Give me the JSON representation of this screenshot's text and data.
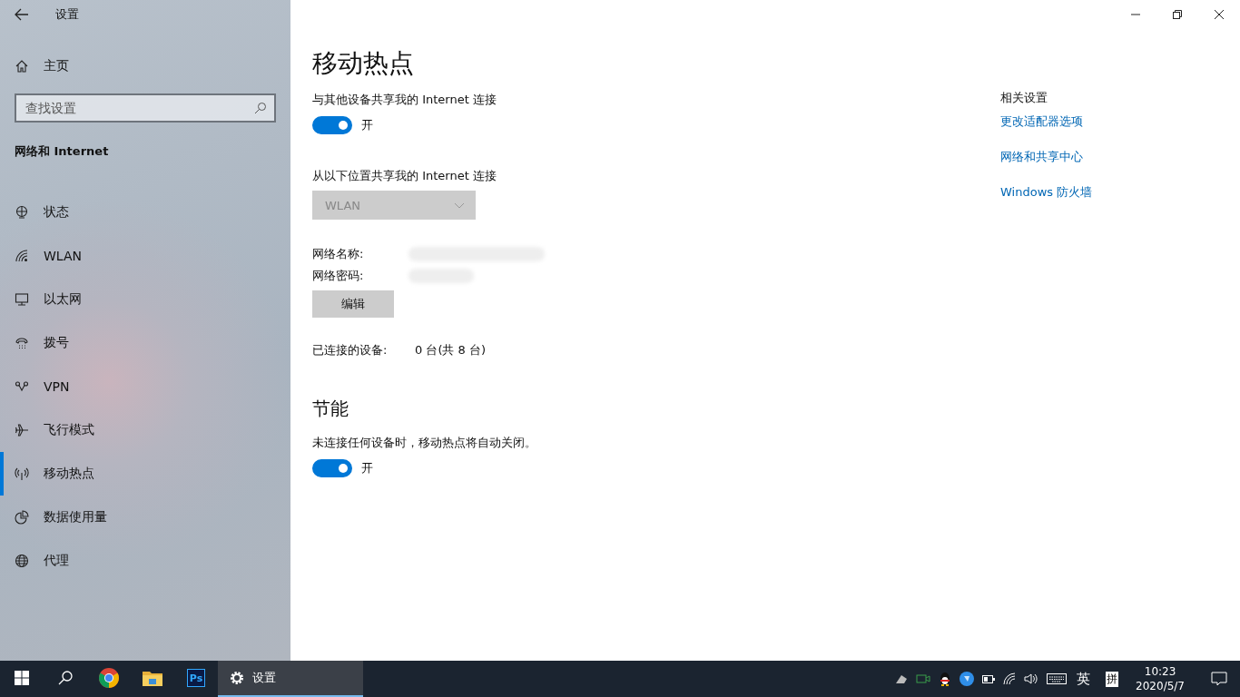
{
  "window": {
    "title": "设置"
  },
  "sidebar": {
    "home": "主页",
    "search": {
      "placeholder": "查找设置"
    },
    "section": "网络和 Internet",
    "items": [
      {
        "label": "状态",
        "kind": "status",
        "selected": false
      },
      {
        "label": "WLAN",
        "kind": "wlan",
        "selected": false
      },
      {
        "label": "以太网",
        "kind": "ethernet",
        "selected": false
      },
      {
        "label": "拨号",
        "kind": "dialup",
        "selected": false
      },
      {
        "label": "VPN",
        "kind": "vpn",
        "selected": false
      },
      {
        "label": "飞行模式",
        "kind": "airplane",
        "selected": false
      },
      {
        "label": "移动热点",
        "kind": "hotspot",
        "selected": true
      },
      {
        "label": "数据使用量",
        "kind": "data",
        "selected": false
      },
      {
        "label": "代理",
        "kind": "proxy",
        "selected": false
      }
    ]
  },
  "main": {
    "title": "移动热点",
    "share": {
      "label": "与其他设备共享我的 Internet 连接",
      "on": true,
      "state": "开"
    },
    "source": {
      "label": "从以下位置共享我的 Internet 连接",
      "value": "WLAN",
      "disabled": true
    },
    "network_name": {
      "label": "网络名称:"
    },
    "network_password": {
      "label": "网络密码:"
    },
    "edit_button": "编辑",
    "connected": {
      "label": "已连接的设备:",
      "value": "0 台(共 8 台)"
    },
    "power_saving": {
      "heading": "节能",
      "description": "未连接任何设备时，移动热点将自动关闭。",
      "on": true,
      "state": "开"
    }
  },
  "related": {
    "heading": "相关设置",
    "links": [
      "更改适配器选项",
      "网络和共享中心",
      "Windows 防火墙"
    ]
  },
  "taskbar": {
    "apps": [
      {
        "kind": "start",
        "selected": false
      },
      {
        "kind": "search",
        "selected": false
      },
      {
        "kind": "chrome",
        "selected": false
      },
      {
        "kind": "folder",
        "selected": false
      },
      {
        "kind": "photoshop",
        "label": "Ps",
        "selected": false
      },
      {
        "kind": "settings",
        "label": "设置",
        "selected": true
      }
    ],
    "ime_mode": "英",
    "ime": "拼",
    "time": "10:23",
    "date": "2020/5/7"
  }
}
